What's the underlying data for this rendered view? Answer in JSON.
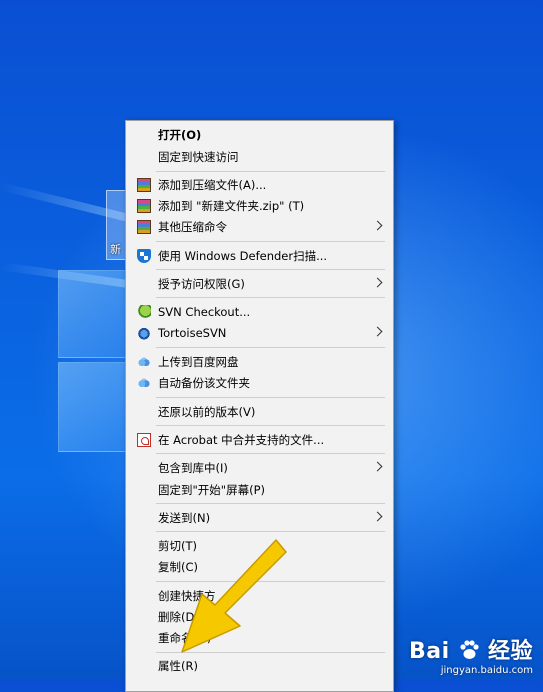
{
  "desktop": {
    "folder_label": "新"
  },
  "context_menu": {
    "items": [
      {
        "label": "打开(O)"
      },
      {
        "label": "固定到快速访问"
      },
      {
        "label": "添加到压缩文件(A)...",
        "icon": "winrar-icon"
      },
      {
        "label": "添加到 \"新建文件夹.zip\" (T)",
        "icon": "winrar-icon"
      },
      {
        "label": "其他压缩命令",
        "icon": "winrar-icon"
      },
      {
        "label": "使用 Windows Defender扫描...",
        "icon": "windows-defender-shield-icon"
      },
      {
        "label": "授予访问权限(G)"
      },
      {
        "label": "SVN Checkout...",
        "icon": "svn-checkout-icon"
      },
      {
        "label": "TortoiseSVN",
        "icon": "tortoisesvn-icon"
      },
      {
        "label": "上传到百度网盘",
        "icon": "baidu-netdisk-icon"
      },
      {
        "label": "自动备份该文件夹",
        "icon": "baidu-netdisk-icon"
      },
      {
        "label": "还原以前的版本(V)"
      },
      {
        "label": "在 Acrobat 中合并支持的文件...",
        "icon": "acrobat-icon"
      },
      {
        "label": "包含到库中(I)"
      },
      {
        "label": "固定到\"开始\"屏幕(P)"
      },
      {
        "label": "发送到(N)"
      },
      {
        "label": "剪切(T)"
      },
      {
        "label": "复制(C)"
      },
      {
        "label": "创建快捷方"
      },
      {
        "label": "删除(D)"
      },
      {
        "label": "重命名(M)"
      },
      {
        "label": "属性(R)"
      }
    ]
  },
  "watermark": {
    "brand_left": "Bai",
    "brand_right": "经验",
    "url": "jingyan.baidu.com"
  },
  "colors": {
    "arrow": "#f5c800",
    "menu_bg": "#f2f2f2",
    "desktop": "#0a5ad8"
  }
}
